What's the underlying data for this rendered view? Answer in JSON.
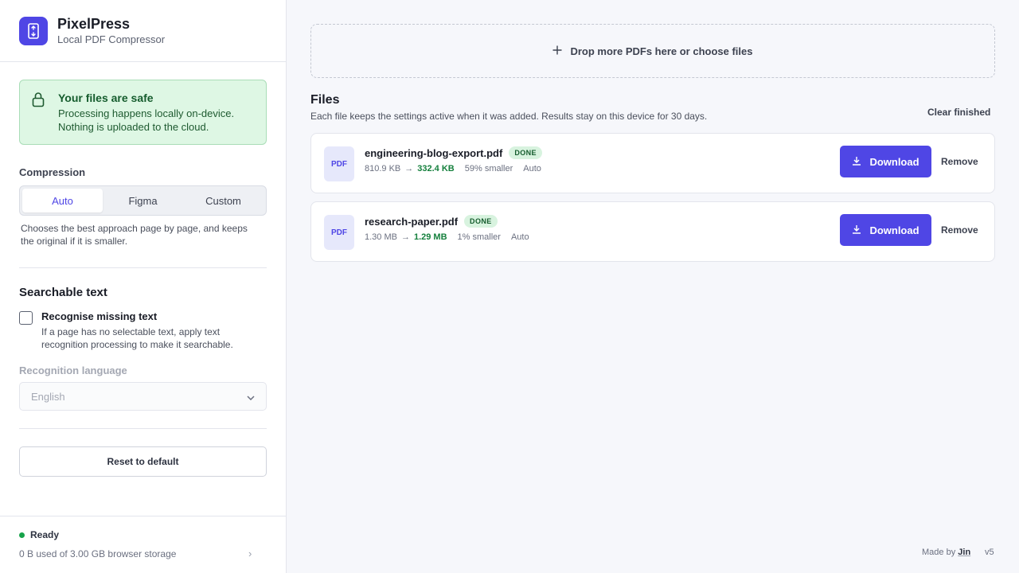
{
  "app": {
    "title": "PixelPress",
    "subtitle": "Local PDF Compressor",
    "accent": "#4f46e5"
  },
  "safety": {
    "title": "Your files are safe",
    "line1": "Processing happens locally on-device.",
    "line2": "Nothing is uploaded to the cloud.",
    "icon": "lock-icon"
  },
  "compression": {
    "label": "Compression",
    "options": [
      "Auto",
      "Figma",
      "Custom"
    ],
    "selected": "Auto",
    "help": "Chooses the best approach page by page, and keeps the original if it is smaller."
  },
  "searchable": {
    "heading": "Searchable text",
    "checkbox_label": "Recognise missing text",
    "checked": false,
    "help": "If a page has no selectable text, apply text recognition processing to make it searchable.",
    "language_label": "Recognition language",
    "language_value": "English"
  },
  "reset_label": "Reset to default",
  "footer": {
    "status": "Ready",
    "storage": "0 B used of 3.00 GB browser storage",
    "chevron": "›"
  },
  "dropzone": {
    "label": "Drop more PDFs here or choose files",
    "icon": "plus-icon"
  },
  "files": {
    "heading": "Files",
    "subtitle": "Each file keeps the settings active when it was added. Results stay on this device for 30 days.",
    "clear_label": "Clear finished",
    "items": [
      {
        "type_badge": "PDF",
        "name": "engineering-blog-export.pdf",
        "status": "DONE",
        "original_size": "810.9 KB",
        "arrow": "→",
        "new_size": "332.4 KB",
        "reduction": "59% smaller",
        "mode": "Auto",
        "download_label": "Download",
        "remove_label": "Remove"
      },
      {
        "type_badge": "PDF",
        "name": "research-paper.pdf",
        "status": "DONE",
        "original_size": "1.30 MB",
        "arrow": "→",
        "new_size": "1.29 MB",
        "reduction": "1% smaller",
        "mode": "Auto",
        "download_label": "Download",
        "remove_label": "Remove"
      }
    ]
  },
  "credits": {
    "made_by": "Made by",
    "author": "Jin",
    "version": "v5"
  }
}
